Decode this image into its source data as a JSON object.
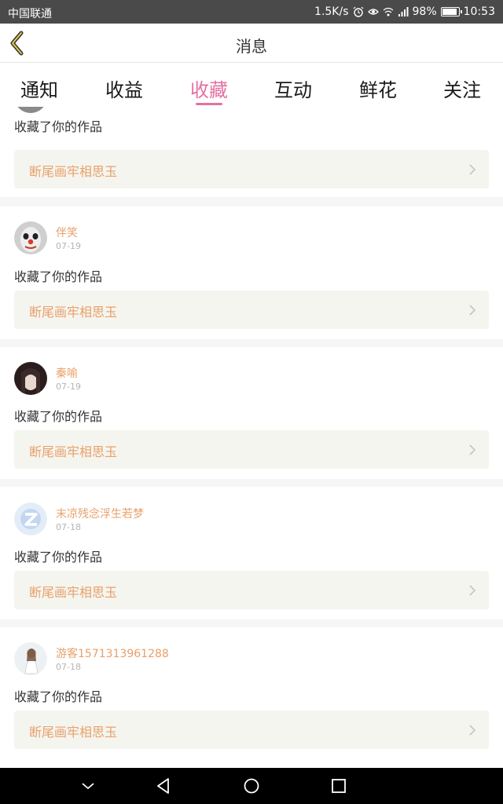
{
  "status_bar": {
    "carrier": "中国联通",
    "speed": "1.5K/s",
    "battery": "98%",
    "time": "10:53"
  },
  "header": {
    "title": "消息",
    "back_icon": "back-chevron-icon"
  },
  "tabs": [
    {
      "label": "通知",
      "active": false
    },
    {
      "label": "收益",
      "active": false
    },
    {
      "label": "收藏",
      "active": true
    },
    {
      "label": "互动",
      "active": false
    },
    {
      "label": "鲜花",
      "active": false
    },
    {
      "label": "关注",
      "active": false
    }
  ],
  "messages": [
    {
      "user": "",
      "date": "",
      "action": "收藏了你的作品",
      "work": "断尾画牢相思玉"
    },
    {
      "user": "伴笑",
      "date": "07-19",
      "action": "收藏了你的作品",
      "work": "断尾画牢相思玉"
    },
    {
      "user": "秦喻",
      "date": "07-19",
      "action": "收藏了你的作品",
      "work": "断尾画牢相思玉"
    },
    {
      "user": "末凉残念浮生若梦",
      "date": "07-18",
      "action": "收藏了你的作品",
      "work": "断尾画牢相思玉"
    },
    {
      "user": "游客1571313961288",
      "date": "07-18",
      "action": "收藏了你的作品",
      "work": "断尾画牢相思玉"
    }
  ],
  "colors": {
    "accent": "#e56fa3",
    "username": "#e8a06a",
    "work_bg": "#f5f5ef"
  }
}
